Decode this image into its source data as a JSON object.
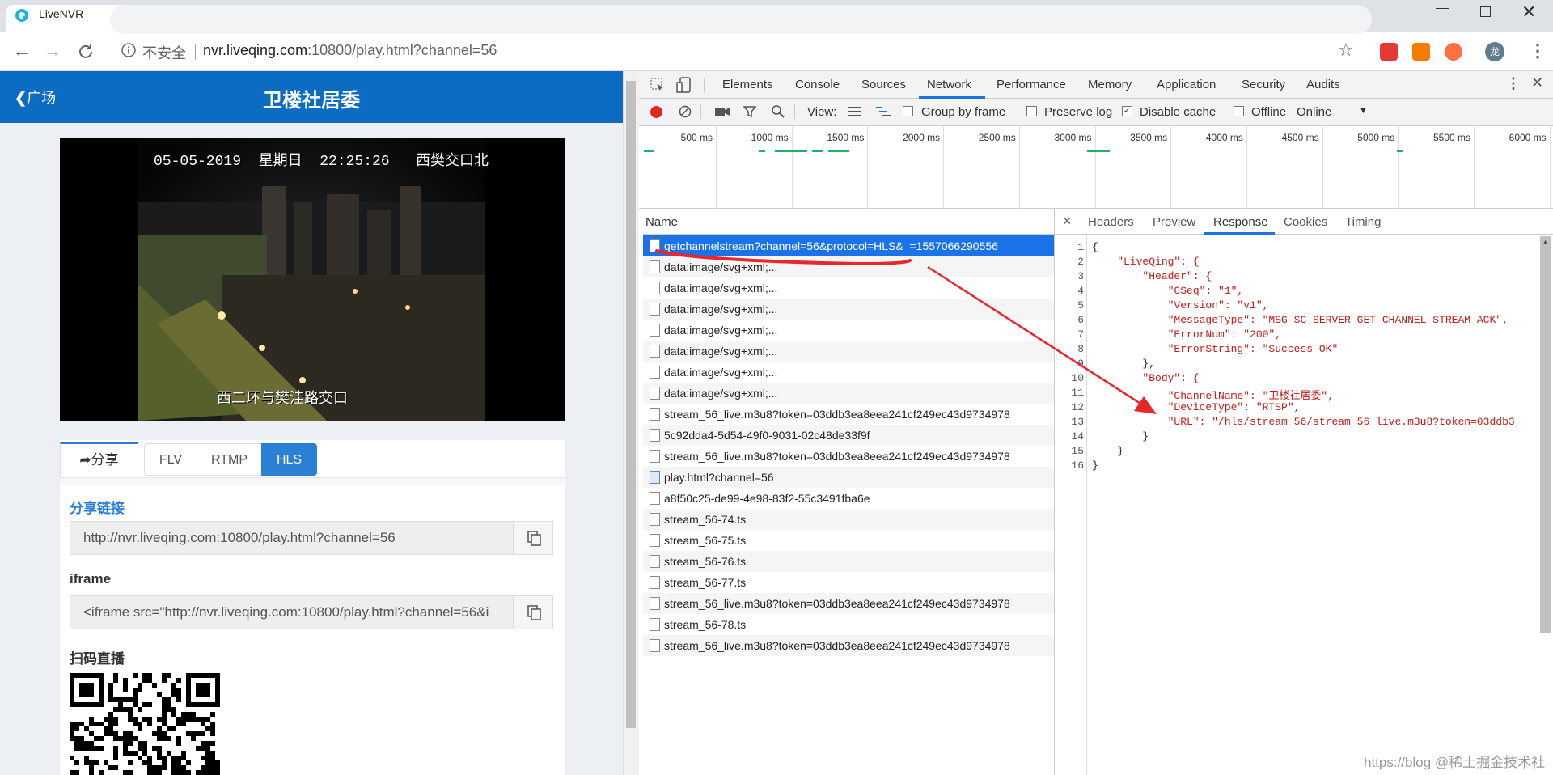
{
  "browser": {
    "tab_title": "LiveNVR",
    "address_insecure": "不安全",
    "address_host": "nvr.liveqing.com",
    "address_rest": ":10800/play.html?channel=56",
    "avatar_label": "龙"
  },
  "app": {
    "back_label": "广场",
    "title": "卫楼社居委",
    "video_overlay_top": "05-05-2019  星期日  22:25:26   西樊交口北",
    "video_overlay_bottom": "西二环与樊洼路交口",
    "share_tab": "分享",
    "protocol_tabs": [
      "FLV",
      "RTMP",
      "HLS"
    ],
    "active_protocol": "HLS",
    "share_link_label": "分享链接",
    "share_link_value": "http://nvr.liveqing.com:10800/play.html?channel=56",
    "iframe_label": "iframe",
    "iframe_value": "<iframe src=\"http://nvr.liveqing.com:10800/play.html?channel=56&i",
    "qr_label": "扫码直播"
  },
  "devtools": {
    "tabs": [
      "Elements",
      "Console",
      "Sources",
      "Network",
      "Performance",
      "Memory",
      "Application",
      "Security",
      "Audits"
    ],
    "active_tab": "Network",
    "toolbar": {
      "view_label": "View:",
      "group_by_frame": "Group by frame",
      "preserve_log": "Preserve log",
      "disable_cache": "Disable cache",
      "offline": "Offline",
      "throttle": "Online"
    },
    "timeline_ticks": [
      "500 ms",
      "1000 ms",
      "1500 ms",
      "2000 ms",
      "2500 ms",
      "3000 ms",
      "3500 ms",
      "4000 ms",
      "4500 ms",
      "5000 ms",
      "5500 ms",
      "6000 ms"
    ],
    "name_header": "Name",
    "requests": [
      "getchannelstream?channel=56&protocol=HLS&_=1557066290556",
      "data:image/svg+xml;...",
      "data:image/svg+xml;...",
      "data:image/svg+xml;...",
      "data:image/svg+xml;...",
      "data:image/svg+xml;...",
      "data:image/svg+xml;...",
      "data:image/svg+xml;...",
      "stream_56_live.m3u8?token=03ddb3ea8eea241cf249ec43d9734978",
      "5c92dda4-5d54-49f0-9031-02c48de33f9f",
      "stream_56_live.m3u8?token=03ddb3ea8eea241cf249ec43d9734978",
      "play.html?channel=56",
      "a8f50c25-de99-4e98-83f2-55c3491fba6e",
      "stream_56-74.ts",
      "stream_56-75.ts",
      "stream_56-76.ts",
      "stream_56-77.ts",
      "stream_56_live.m3u8?token=03ddb3ea8eea241cf249ec43d9734978",
      "stream_56-78.ts",
      "stream_56_live.m3u8?token=03ddb3ea8eea241cf249ec43d9734978"
    ],
    "detail_tabs": [
      "Headers",
      "Preview",
      "Response",
      "Cookies",
      "Timing"
    ],
    "active_detail_tab": "Response",
    "response_lines": [
      "{",
      "    \"LiveQing\": {",
      "        \"Header\": {",
      "            \"CSeq\": \"1\",",
      "            \"Version\": \"v1\",",
      "            \"MessageType\": \"MSG_SC_SERVER_GET_CHANNEL_STREAM_ACK\",",
      "            \"ErrorNum\": \"200\",",
      "            \"ErrorString\": \"Success OK\"",
      "        },",
      "        \"Body\": {",
      "            \"ChannelName\": \"卫楼社居委\",",
      "            \"DeviceType\": \"RTSP\",",
      "            \"URL\": \"/hls/stream_56/stream_56_live.m3u8?token=03ddb3",
      "        }",
      "    }",
      "}"
    ],
    "line_numbers": [
      "1",
      "2",
      "3",
      "4",
      "5",
      "6",
      "7",
      "8",
      "9",
      "10",
      "11",
      "12",
      "13",
      "14",
      "15",
      "16"
    ]
  },
  "watermark": "https://blog @稀土掘金技术社区",
  "colors": {
    "app_header": "#0c6cc3",
    "selected_row": "#1a73e8",
    "annotation": "#e8262c",
    "hls_active": "#2b7fd5"
  }
}
